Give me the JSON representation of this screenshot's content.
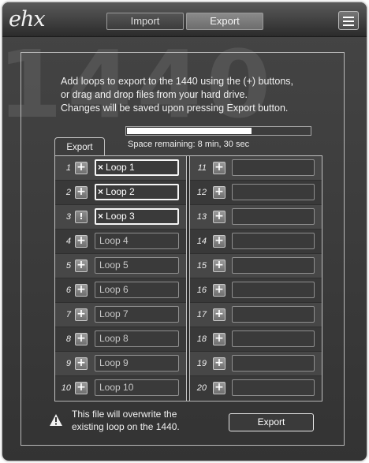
{
  "header": {
    "logo": "ehx",
    "tabs": [
      {
        "label": "Import",
        "active": false
      },
      {
        "label": "Export",
        "active": true
      }
    ],
    "menu_icon": "hamburger-menu-icon"
  },
  "watermark": "1440",
  "instructions": [
    "Add loops to export to the 1440 using the (+) buttons,",
    "or drag and drop files from your hard drive.",
    "Changes will be saved upon pressing Export button."
  ],
  "space": {
    "used_fraction": 0.68,
    "label": "Space remaining: 8 min, 30 sec"
  },
  "export_tab_label": "Export",
  "slots_left": [
    {
      "num": "1",
      "button": "+",
      "name": "Loop 1",
      "selected": true
    },
    {
      "num": "2",
      "button": "+",
      "name": "Loop 2",
      "selected": true
    },
    {
      "num": "3",
      "button": "!",
      "name": "Loop 3",
      "selected": true
    },
    {
      "num": "4",
      "button": "+",
      "name": "Loop 4",
      "selected": false
    },
    {
      "num": "5",
      "button": "+",
      "name": "Loop 5",
      "selected": false
    },
    {
      "num": "6",
      "button": "+",
      "name": "Loop 6",
      "selected": false
    },
    {
      "num": "7",
      "button": "+",
      "name": "Loop 7",
      "selected": false
    },
    {
      "num": "8",
      "button": "+",
      "name": "Loop 8",
      "selected": false
    },
    {
      "num": "9",
      "button": "+",
      "name": "Loop 9",
      "selected": false
    },
    {
      "num": "10",
      "button": "+",
      "name": "Loop 10",
      "selected": false
    }
  ],
  "slots_right": [
    {
      "num": "11",
      "button": "+",
      "name": ""
    },
    {
      "num": "12",
      "button": "+",
      "name": ""
    },
    {
      "num": "13",
      "button": "+",
      "name": ""
    },
    {
      "num": "14",
      "button": "+",
      "name": ""
    },
    {
      "num": "15",
      "button": "+",
      "name": ""
    },
    {
      "num": "16",
      "button": "+",
      "name": ""
    },
    {
      "num": "17",
      "button": "+",
      "name": ""
    },
    {
      "num": "18",
      "button": "+",
      "name": ""
    },
    {
      "num": "19",
      "button": "+",
      "name": ""
    },
    {
      "num": "20",
      "button": "+",
      "name": ""
    }
  ],
  "remove_mark": "×",
  "warning": {
    "icon": "warning-triangle-icon",
    "text_line1": "This file will overwrite the",
    "text_line2": "existing loop on the 1440."
  },
  "export_button": "Export",
  "colors": {
    "background": "#3a3a3a",
    "border": "#c0c0c0",
    "text": "#f0f0f0"
  }
}
